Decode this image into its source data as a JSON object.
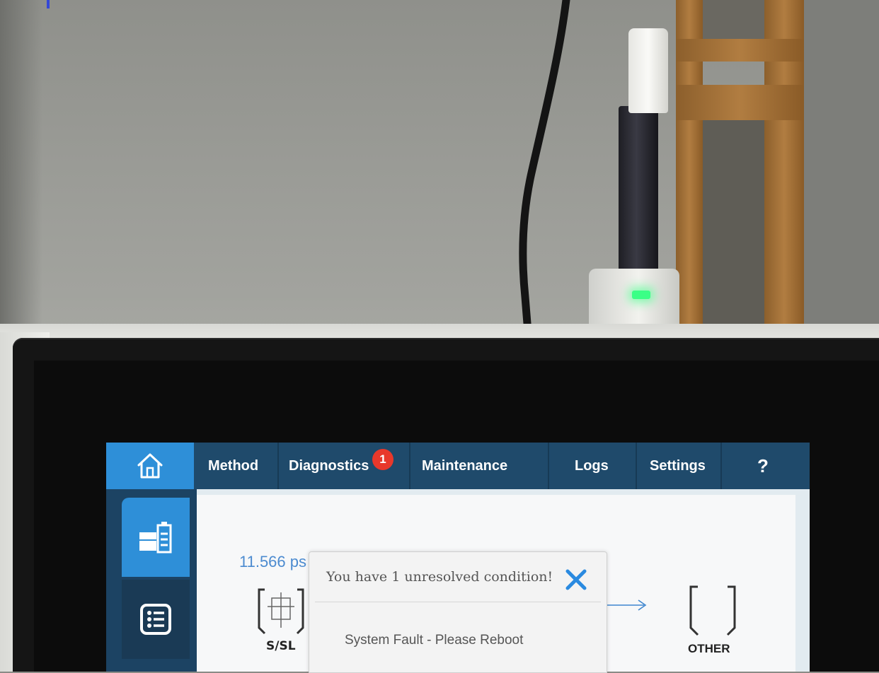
{
  "topbar": {
    "home_icon": "home-icon",
    "tabs": [
      {
        "label": "Method"
      },
      {
        "label": "Diagnostics",
        "badge": "1"
      },
      {
        "label": "Maintenance"
      },
      {
        "label": "Logs"
      },
      {
        "label": "Settings"
      },
      {
        "label": "?"
      }
    ]
  },
  "sidebar": {
    "items": [
      {
        "icon": "instrument-status-icon",
        "active": true
      },
      {
        "icon": "list-icon",
        "active": false
      }
    ]
  },
  "main": {
    "pressure": "11.566 ps",
    "inlet_label": "S/SL",
    "detector_label": "OTHER"
  },
  "dialog": {
    "title": "You have 1 unresolved condition!",
    "message": "System Fault - Please Reboot",
    "close_icon": "close-icon"
  },
  "colors": {
    "accent": "#2e8fd8",
    "nav_bar": "#1f4a6b",
    "badge": "#e8382b",
    "pressure_text": "#4c8bd0",
    "led": "#3bff86"
  }
}
